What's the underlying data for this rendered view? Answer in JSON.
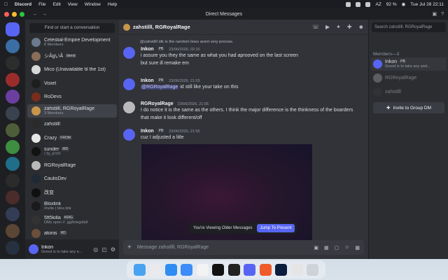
{
  "menubar": {
    "app": "Discord",
    "items": [
      "File",
      "Edit",
      "View",
      "Window",
      "Help"
    ],
    "battery": "92 %",
    "input_source": "AZ",
    "clock": "Tue Jul 28  22:11"
  },
  "window": {
    "title": "Direct Messages"
  },
  "dm_sidebar": {
    "search_placeholder": "Find or start a conversation",
    "items": [
      {
        "name": "Celestial-Empire Development",
        "sub": "8 Members",
        "color": "#6b7a8c"
      },
      {
        "name": "シÂgいÂ",
        "badge": "blend",
        "color": "#8a6d58"
      },
      {
        "name": "Mico (Unavailable til the 1st)",
        "color": "#d8d8d8"
      },
      {
        "name": "Voxel",
        "color": "#1e1e1e"
      },
      {
        "name": "RoDevs",
        "color": "#7a2d1b"
      },
      {
        "name": "zahstilll, RGRoyalRage",
        "sub": "3 Members",
        "color": "#c7964b",
        "selected": true
      },
      {
        "name": "zahstilll",
        "color": "#2a2a2a"
      },
      {
        "name": "Crazy",
        "badge": "FROM",
        "color": "#e6e6e6"
      },
      {
        "name": "sunder",
        "badge": "MD",
        "sub": "/ 3y_EVO",
        "color": "#121212"
      },
      {
        "name": "RGRoyalRage",
        "color": "#b9b9b9"
      },
      {
        "name": "CaulisDev",
        "color": "#1f2936"
      },
      {
        "name": "改变",
        "color": "#101010"
      },
      {
        "name": "Bloxlink",
        "sub": "/invite | blox.link",
        "color": "#1a1a1a"
      },
      {
        "name": "5ft5killa",
        "badge": "KRIG",
        "sub": "DMs open // .gg/kriegsfall",
        "color": "#333333"
      },
      {
        "name": "atonis",
        "badge": "HD",
        "color": "#6b4f3a"
      }
    ]
  },
  "user_panel": {
    "name": "Inkon",
    "status": "Greed is to take any e..."
  },
  "chat": {
    "header_name": "zahstilll, RGRoyalRage",
    "reply_preview": "@zahstilll idk is the random lines arent very precise.",
    "messages": [
      {
        "author": "Inkon",
        "tag": "PB",
        "time": "23/06/2026, 02:10",
        "lines": [
          "i assure you they the same as what you had aprooved on the last screen",
          "but sure ill remake em"
        ]
      },
      {
        "author": "Inkon",
        "tag": "PB",
        "time": "23/06/2026, 21:53",
        "mention": "@RGRoyalRage",
        "lines": [
          "id still like your take on this"
        ]
      },
      {
        "author": "RGRoyalRage",
        "time": "23/06/2026, 21:55",
        "lines": [
          "I do notice it is the same as the others. I think the major difference is the thinkness of the boarders",
          "that make it look different/off"
        ]
      },
      {
        "author": "Inkon",
        "tag": "PB",
        "time": "23/06/2026, 21:55",
        "lines": [
          "cuz I adjusted a litle"
        ]
      }
    ],
    "older_notice": "You're Viewing Older Messages",
    "jump_button": "Jump To Present",
    "composer_placeholder": "Message zahstilll, RGRoyalRage"
  },
  "members_panel": {
    "search_placeholder": "Search zahstilll, RGRoyalRage",
    "header": "Members—3",
    "members": [
      {
        "name": "Inkon",
        "tag": "PB",
        "sub": "Greed is to take any and...",
        "color": "#5865f2"
      },
      {
        "name": "RGRoyalRage",
        "color": "#9a9a9a"
      },
      {
        "name": "zahstilll",
        "color": "#3a3a3a"
      }
    ],
    "invite_button": "Invite to Group DM"
  },
  "colors": {
    "blurple": "#5865f2",
    "online": "#23a55a",
    "chat_bg": "#313338",
    "sidebar_bg": "#2b2d31"
  }
}
